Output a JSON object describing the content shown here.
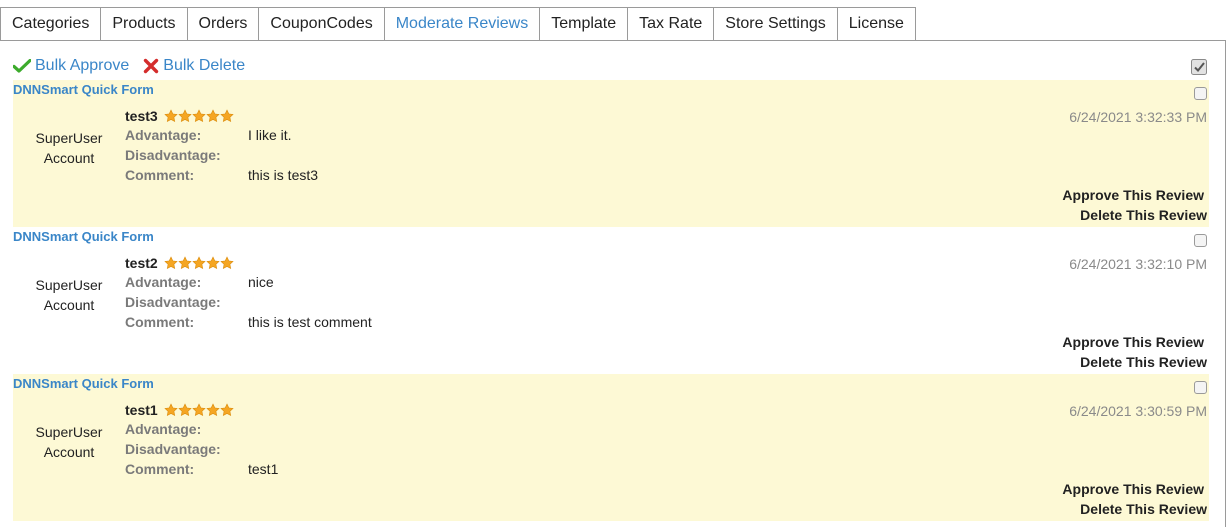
{
  "tabs": [
    {
      "label": "Categories"
    },
    {
      "label": "Products"
    },
    {
      "label": "Orders"
    },
    {
      "label": "CouponCodes"
    },
    {
      "label": "Moderate Reviews",
      "active": true
    },
    {
      "label": "Template"
    },
    {
      "label": "Tax Rate"
    },
    {
      "label": "Store Settings"
    },
    {
      "label": "License"
    }
  ],
  "toolbar": {
    "bulk_approve": "Bulk Approve",
    "bulk_delete": "Bulk Delete"
  },
  "labels": {
    "advantage": "Advantage:",
    "disadvantage": "Disadvantage:",
    "comment": "Comment:",
    "approve": "Approve This Review",
    "delete": "Delete This Review"
  },
  "reviews": [
    {
      "product": "DNNSmart Quick Form",
      "user_line1": "SuperUser",
      "user_line2": "Account",
      "title": "test3",
      "rating": 5,
      "advantage": "I like it.",
      "disadvantage": "",
      "comment": "this is test3",
      "date": "6/24/2021 3:32:33 PM"
    },
    {
      "product": "DNNSmart Quick Form",
      "user_line1": "SuperUser",
      "user_line2": "Account",
      "title": "test2",
      "rating": 5,
      "advantage": "nice",
      "disadvantage": "",
      "comment": "this is test comment",
      "date": "6/24/2021 3:32:10 PM"
    },
    {
      "product": "DNNSmart Quick Form",
      "user_line1": "SuperUser",
      "user_line2": "Account",
      "title": "test1",
      "rating": 5,
      "advantage": "",
      "disadvantage": "",
      "comment": "test1",
      "date": "6/24/2021 3:30:59 PM"
    }
  ],
  "colors": {
    "link": "#3a86c8",
    "highlight_row": "#fdf9d5",
    "star": "#f5a623"
  }
}
